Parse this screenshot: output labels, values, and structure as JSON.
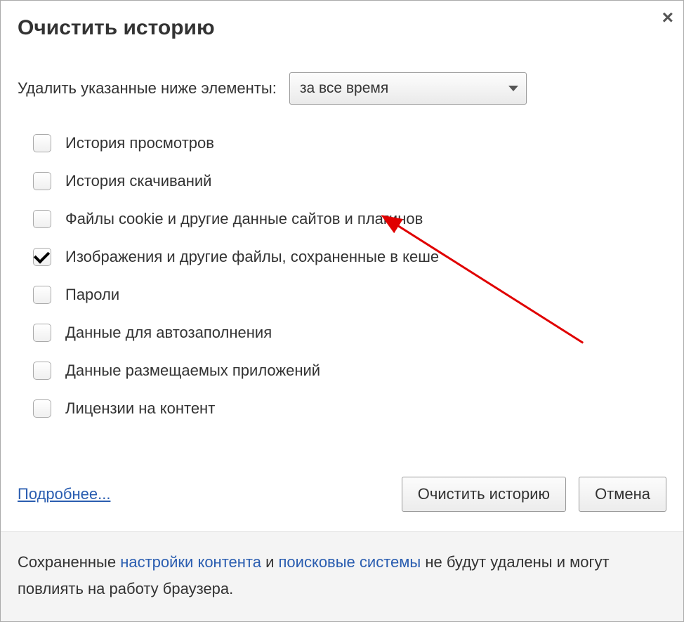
{
  "dialog": {
    "title": "Очистить историю",
    "close_icon": "×"
  },
  "timeRange": {
    "label": "Удалить указанные ниже элементы:",
    "selected": "за все время"
  },
  "options": [
    {
      "label": "История просмотров",
      "checked": false
    },
    {
      "label": "История скачиваний",
      "checked": false
    },
    {
      "label": "Файлы cookie и другие данные сайтов и плагинов",
      "checked": false
    },
    {
      "label": "Изображения и другие файлы, сохраненные в кеше",
      "checked": true
    },
    {
      "label": "Пароли",
      "checked": false
    },
    {
      "label": "Данные для автозаполнения",
      "checked": false
    },
    {
      "label": "Данные размещаемых приложений",
      "checked": false
    },
    {
      "label": "Лицензии на контент",
      "checked": false
    }
  ],
  "footer": {
    "moreLink": "Подробнее...",
    "clearButton": "Очистить историю",
    "cancelButton": "Отмена"
  },
  "note": {
    "text1": "Сохраненные ",
    "link1": "настройки контента",
    "text2": " и ",
    "link2": "поисковые системы",
    "text3": " не будут удалены и могут повлиять на работу браузера."
  }
}
